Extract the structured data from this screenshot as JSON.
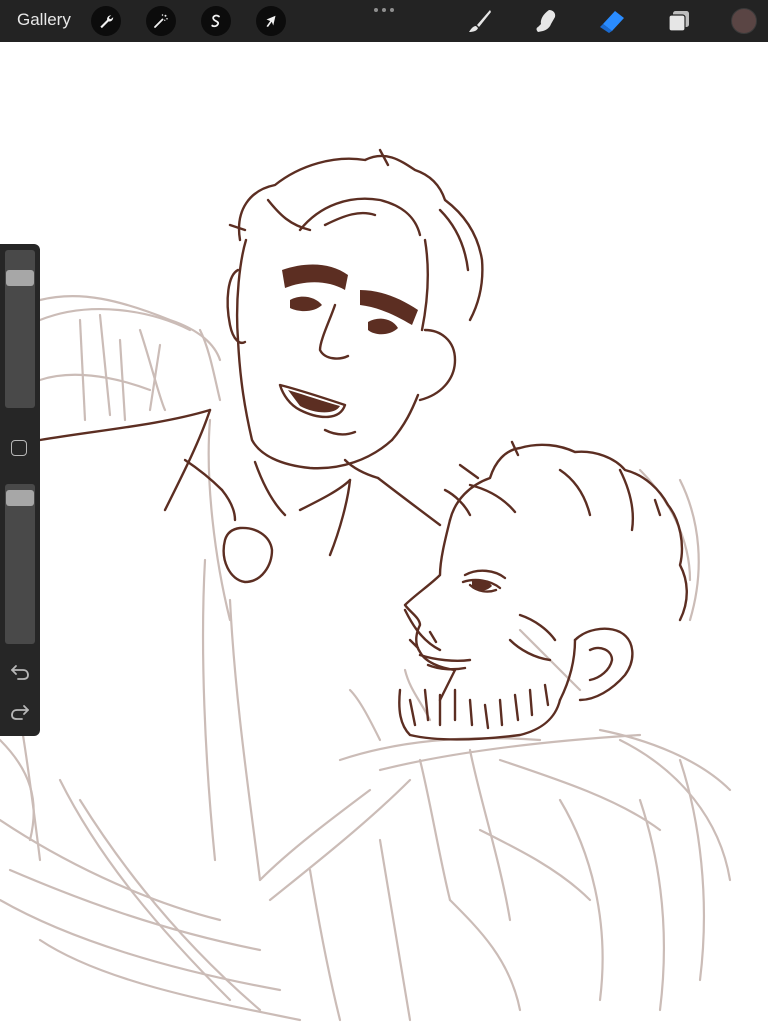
{
  "topbar": {
    "gallery_label": "Gallery",
    "tools_left": [
      {
        "name": "actions",
        "icon": "wrench-icon"
      },
      {
        "name": "adjustments",
        "icon": "magic-wand-icon"
      },
      {
        "name": "selection",
        "icon": "selection-s-icon"
      },
      {
        "name": "transform",
        "icon": "arrow-cursor-icon"
      }
    ],
    "tools_right": [
      {
        "name": "brush",
        "icon": "brush-icon",
        "active": false
      },
      {
        "name": "smudge",
        "icon": "smudge-finger-icon",
        "active": false
      },
      {
        "name": "eraser",
        "icon": "eraser-icon",
        "active": true
      },
      {
        "name": "layers",
        "icon": "layers-icon",
        "active": false
      }
    ],
    "current_color": "#5a4544",
    "active_tool_color": "#2a8cff"
  },
  "sidebar": {
    "brush_size_level": 0.86,
    "opacity_level": 0.96
  },
  "colors": {
    "lineart": "#5c2e22",
    "sketch": "#cbbcb7",
    "background": "#ffffff"
  }
}
